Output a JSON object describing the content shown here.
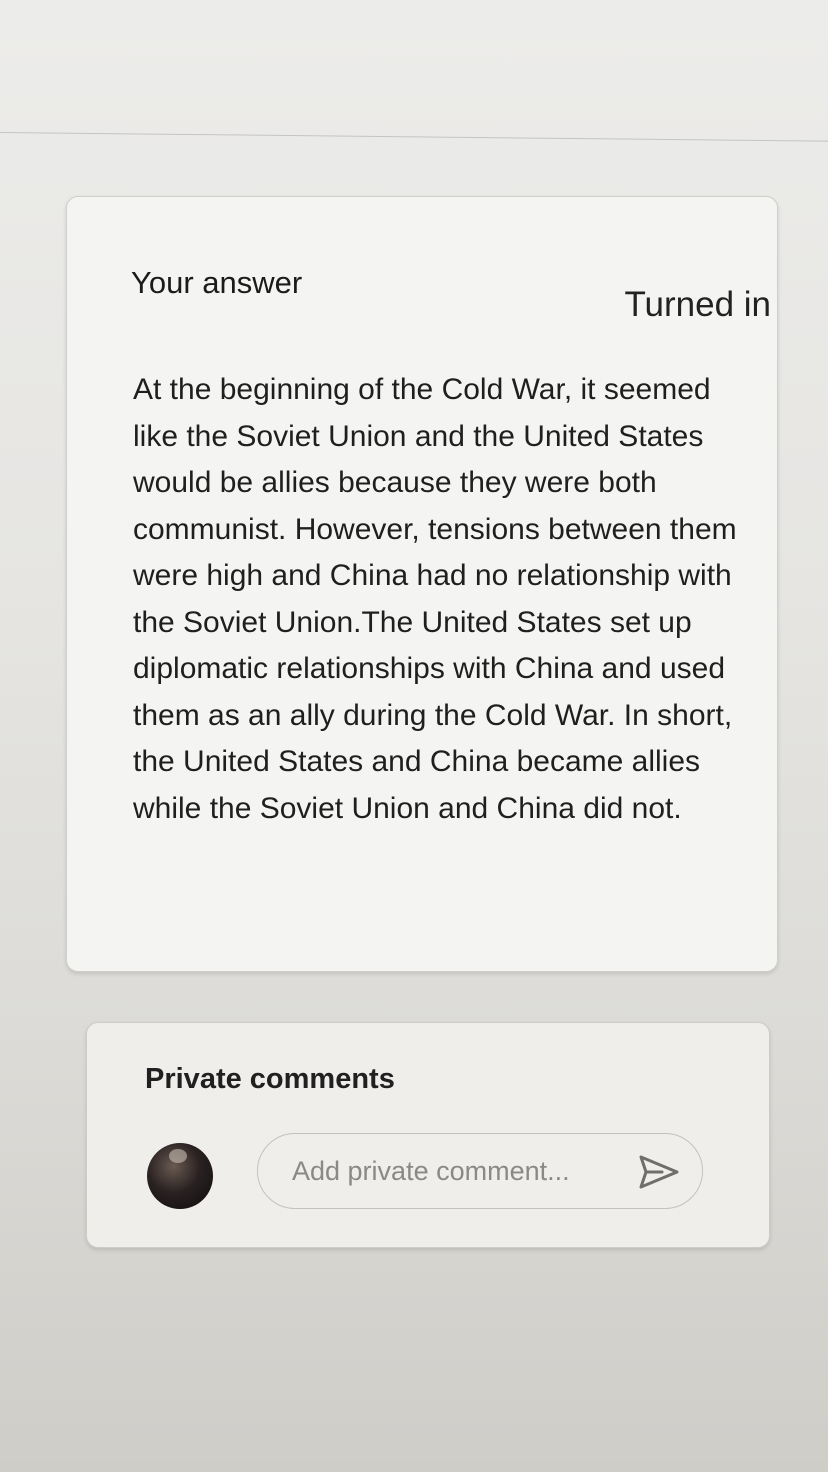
{
  "answer_card": {
    "title": "Your answer",
    "status": "Turned in",
    "answer_text": "At the beginning of the Cold War, it seemed like the Soviet Union and the United States would be allies because they were both communist. However, tensions between them were high and China had no relationship with the Soviet Union.The United States set up diplomatic relationships with China and used them as an ally during the Cold War. In short, the United States and China became allies while the Soviet Union and China did not."
  },
  "private_comments": {
    "title": "Private comments",
    "placeholder": "Add private comment..."
  },
  "icons": {
    "avatar": "user-avatar",
    "send": "send-icon"
  },
  "colors": {
    "icon": "#6f6e6b",
    "background": "#e6e5e2"
  }
}
